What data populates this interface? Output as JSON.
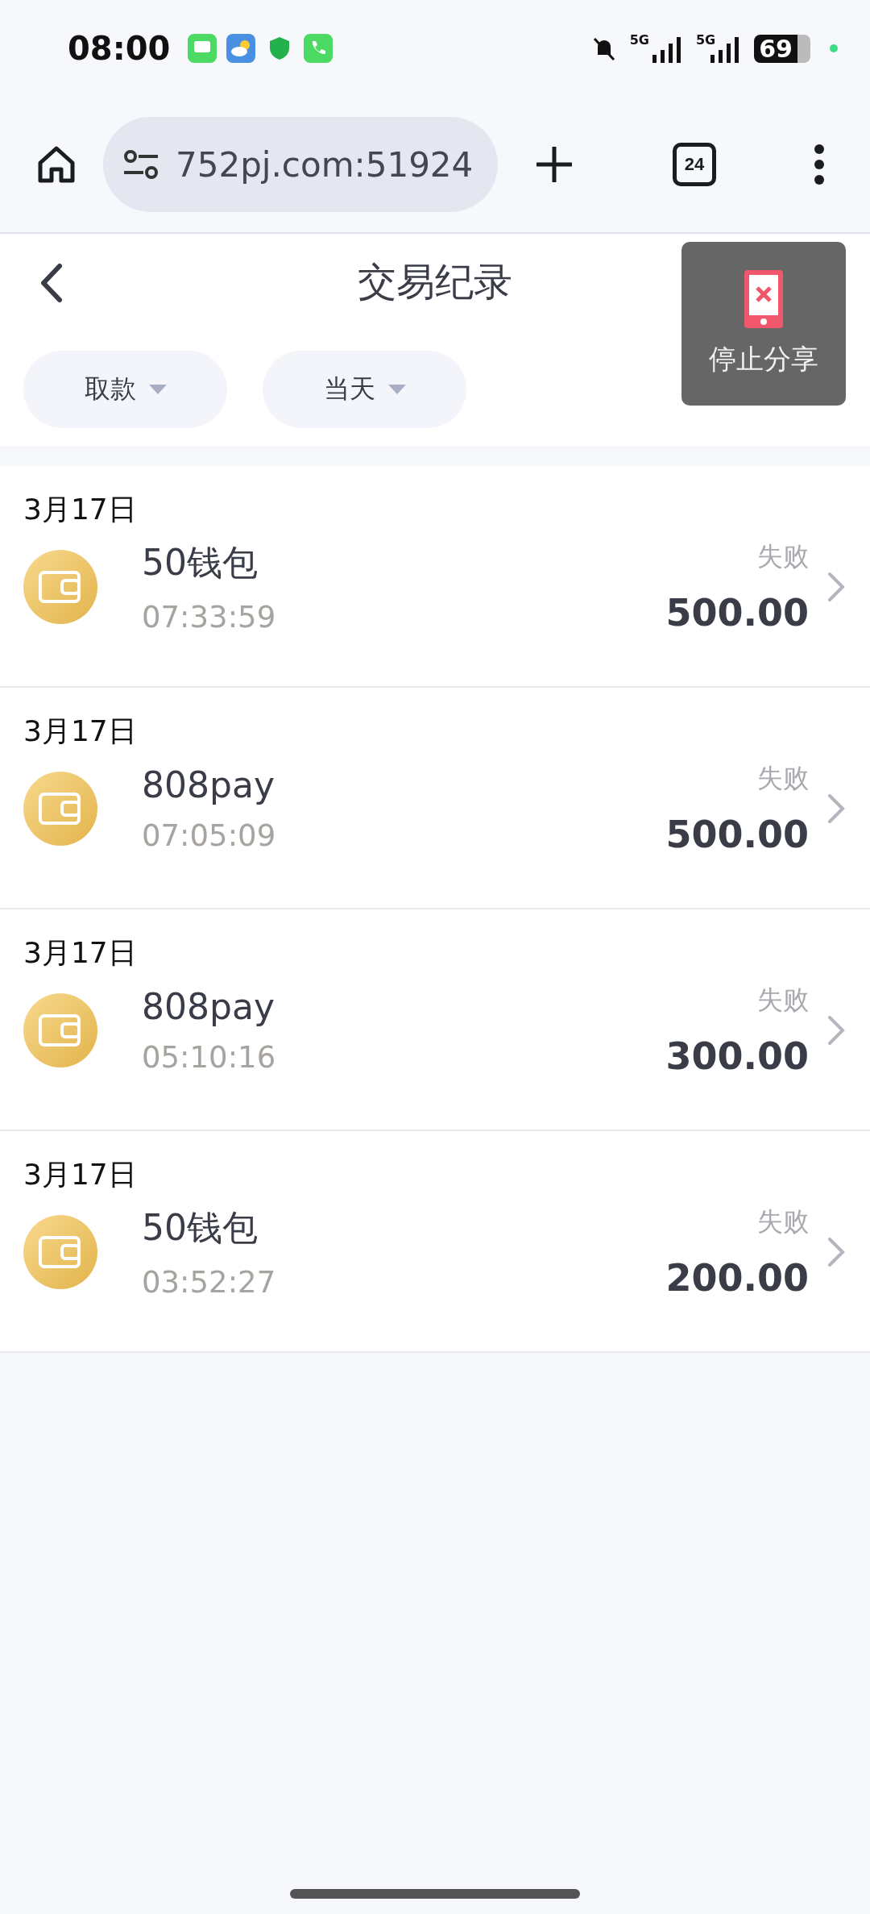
{
  "status_bar": {
    "time": "08:00",
    "networks": [
      "5G",
      "5G"
    ],
    "battery": "69"
  },
  "browser": {
    "url": "752pj.com:51924",
    "tab_count": "24"
  },
  "header": {
    "title": "交易纪录"
  },
  "filters": [
    {
      "label": "取款"
    },
    {
      "label": "当天"
    }
  ],
  "share_overlay": {
    "label": "停止分享"
  },
  "transactions": [
    {
      "date": "3月17日",
      "name": "50钱包",
      "time": "07:33:59",
      "status": "失败",
      "amount": "500.00"
    },
    {
      "date": "3月17日",
      "name": "808pay",
      "time": "07:05:09",
      "status": "失败",
      "amount": "500.00"
    },
    {
      "date": "3月17日",
      "name": "808pay",
      "time": "05:10:16",
      "status": "失败",
      "amount": "300.00"
    },
    {
      "date": "3月17日",
      "name": "50钱包",
      "time": "03:52:27",
      "status": "失败",
      "amount": "200.00"
    }
  ]
}
